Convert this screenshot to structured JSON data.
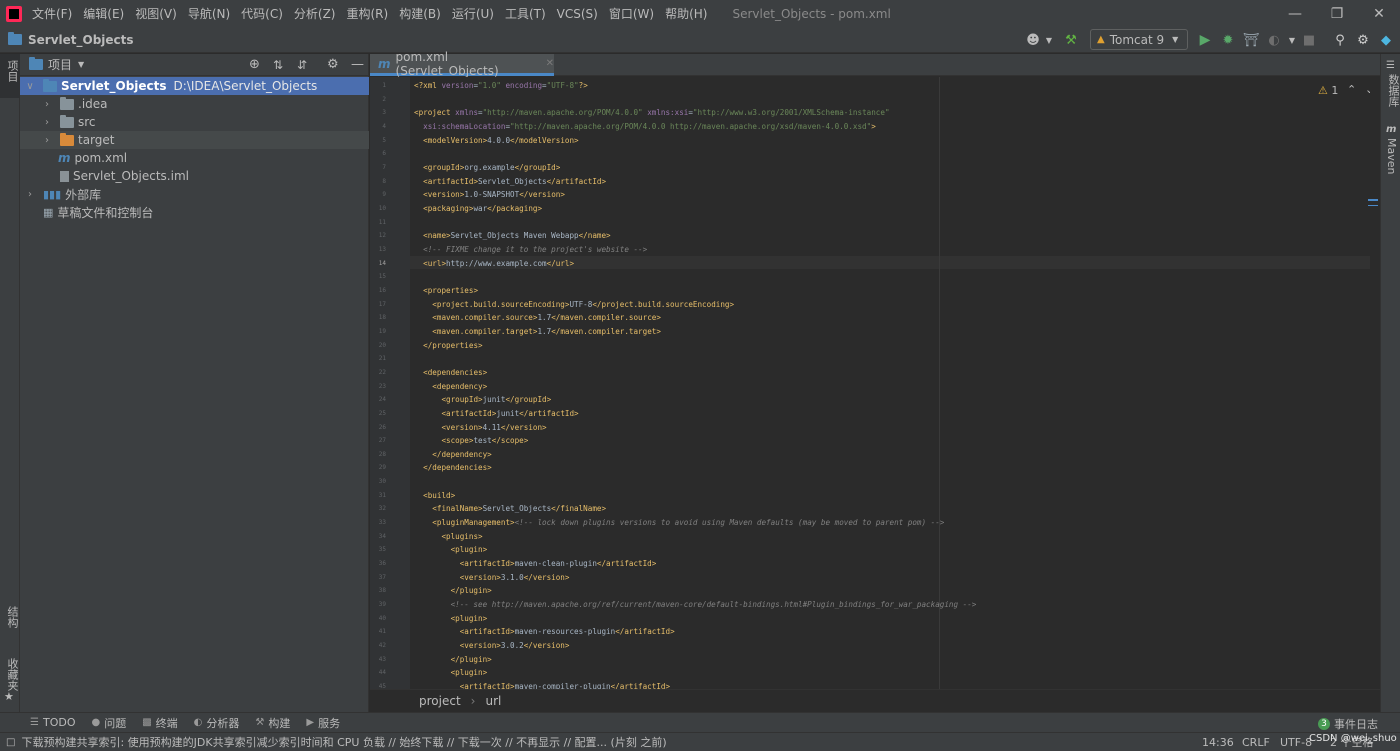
{
  "menu": {
    "items": [
      "文件(F)",
      "编辑(E)",
      "视图(V)",
      "导航(N)",
      "代码(C)",
      "分析(Z)",
      "重构(R)",
      "构建(B)",
      "运行(U)",
      "工具(T)",
      "VCS(S)",
      "窗口(W)",
      "帮助(H)"
    ],
    "window_title": "Servlet_Objects - pom.xml"
  },
  "navbar": {
    "project_name": "Servlet_Objects",
    "run_config": "Tomcat 9"
  },
  "project_panel": {
    "header_label": "项目",
    "tree": [
      {
        "label": "Servlet_Objects",
        "path": "D:\\IDEA\\Servlet_Objects"
      },
      {
        "label": ".idea"
      },
      {
        "label": "src"
      },
      {
        "label": "target"
      },
      {
        "label": "pom.xml"
      },
      {
        "label": "Servlet_Objects.iml"
      },
      {
        "label": "外部库"
      },
      {
        "label": "草稿文件和控制台"
      }
    ]
  },
  "left_stripe": {
    "project": "项目",
    "structure": "结构",
    "favorites": "收藏夹"
  },
  "right_stripe": {
    "database": "数据库",
    "maven": "Maven"
  },
  "editor": {
    "tab_label": "pom.xml (Servlet_Objects)",
    "warnings": "1",
    "breadcrumb": [
      "project",
      "url"
    ],
    "lines": [
      "<?xml version=\"1.0\" encoding=\"UTF-8\"?>",
      "",
      "<project xmlns=\"http://maven.apache.org/POM/4.0.0\" xmlns:xsi=\"http://www.w3.org/2001/XMLSchema-instance\"",
      "  xsi:schemaLocation=\"http://maven.apache.org/POM/4.0.0 http://maven.apache.org/xsd/maven-4.0.0.xsd\">",
      "  <modelVersion>4.0.0</modelVersion>",
      "",
      "  <groupId>org.example</groupId>",
      "  <artifactId>Servlet_Objects</artifactId>",
      "  <version>1.0-SNAPSHOT</version>",
      "  <packaging>war</packaging>",
      "",
      "  <name>Servlet_Objects Maven Webapp</name>",
      "  <!-- FIXME change it to the project's website -->",
      "  <url>http://www.example.com</url>",
      "",
      "  <properties>",
      "    <project.build.sourceEncoding>UTF-8</project.build.sourceEncoding>",
      "    <maven.compiler.source>1.7</maven.compiler.source>",
      "    <maven.compiler.target>1.7</maven.compiler.target>",
      "  </properties>",
      "",
      "  <dependencies>",
      "    <dependency>",
      "      <groupId>junit</groupId>",
      "      <artifactId>junit</artifactId>",
      "      <version>4.11</version>",
      "      <scope>test</scope>",
      "    </dependency>",
      "  </dependencies>",
      "",
      "  <build>",
      "    <finalName>Servlet_Objects</finalName>",
      "    <pluginManagement><!-- lock down plugins versions to avoid using Maven defaults (may be moved to parent pom) -->",
      "      <plugins>",
      "        <plugin>",
      "          <artifactId>maven-clean-plugin</artifactId>",
      "          <version>3.1.0</version>",
      "        </plugin>",
      "        <!-- see http://maven.apache.org/ref/current/maven-core/default-bindings.html#Plugin_bindings_for_war_packaging -->",
      "        <plugin>",
      "          <artifactId>maven-resources-plugin</artifactId>",
      "          <version>3.0.2</version>",
      "        </plugin>",
      "        <plugin>",
      "          <artifactId>maven-compiler-plugin</artifactId>"
    ]
  },
  "tool_windows": [
    "TODO",
    "问题",
    "终端",
    "分析器",
    "构建",
    "服务"
  ],
  "event_log": {
    "count": "3",
    "label": "事件日志"
  },
  "status": {
    "message": "下载预构建共享索引: 使用预构建的JDK共享索引减少索引时间和 CPU 负载 // 始终下载 // 下载一次 // 不再显示 // 配置... (片刻 之前)",
    "position": "14:36",
    "line_sep": "CRLF",
    "encoding": "UTF-8",
    "indent": "2 个空格",
    "watermark": "CSDN @wei_shuo"
  }
}
